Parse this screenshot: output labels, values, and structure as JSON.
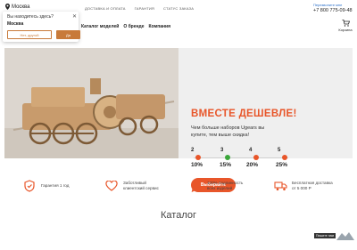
{
  "header": {
    "city": "Москва",
    "top_nav": [
      "ДОСТАВКА И ОПЛАТА",
      "ГАРАНТИЯ",
      "СТАТУС ЗАКАЗА"
    ],
    "callback": "Перезвоните мне",
    "phone": "+7 800 775-09-48",
    "main_nav": [
      "Каталог моделей",
      "О бренде",
      "Компания"
    ],
    "cart_label": "Корзина"
  },
  "city_popup": {
    "question": "Вы находитесь здесь?",
    "city": "Москва",
    "no_label": "Нет, другой",
    "yes_label": "Да"
  },
  "banner": {
    "headline": "ВМЕСТЕ ДЕШЕВЛЕ!",
    "sub": "Чем больше наборов Ugears вы купите, тем выше скидка!",
    "tiers": [
      {
        "count": "2",
        "discount": "10%"
      },
      {
        "count": "3",
        "discount": "15%"
      },
      {
        "count": "4",
        "discount": "20%"
      },
      {
        "count": "5",
        "discount": "25%"
      }
    ],
    "cta": "Выбирайте"
  },
  "features": [
    {
      "icon": "shield-icon",
      "text": "Гарантия 1 год"
    },
    {
      "icon": "heart-icon",
      "text": "Заботливый клиентский сервис"
    },
    {
      "icon": "medal-icon",
      "text": "100% подлинность всех изделий"
    },
    {
      "icon": "truck-icon",
      "text": "Бесплатная доставка от 5 000 Р"
    }
  ],
  "catalog_heading": "Каталог",
  "review_chip": "Пишите нам",
  "colors": {
    "accent": "#e8562a",
    "brand": "#c87a3a"
  }
}
